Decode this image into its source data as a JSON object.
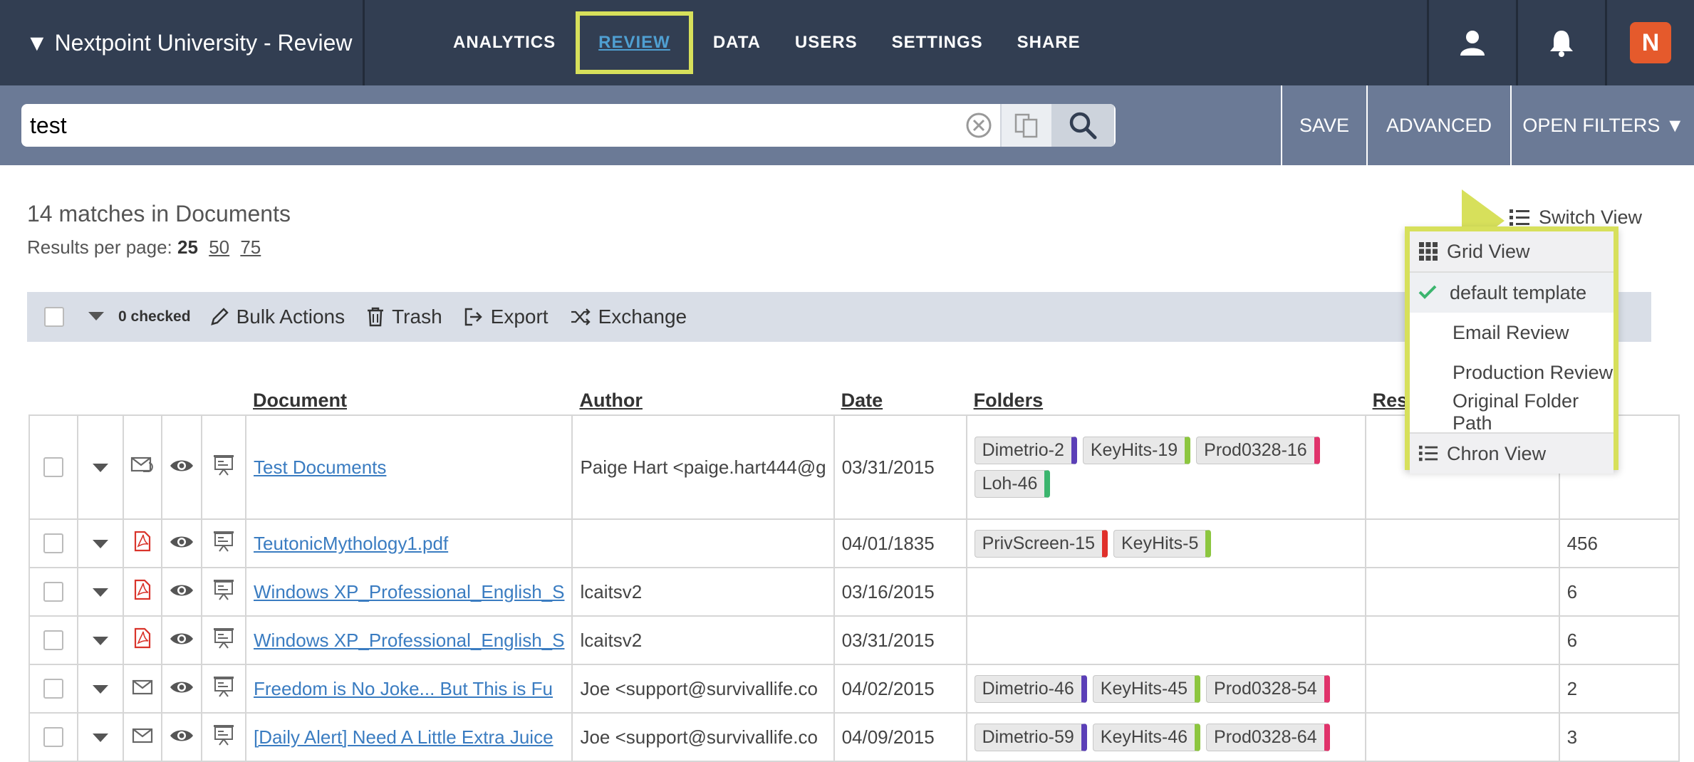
{
  "nav": {
    "brand": "▼ Nextpoint University - Review",
    "links": [
      "ANALYTICS",
      "REVIEW",
      "DATA",
      "USERS",
      "SETTINGS",
      "SHARE"
    ],
    "logo_letter": "N"
  },
  "search": {
    "value": "test",
    "save": "SAVE",
    "advanced": "ADVANCED",
    "open_filters": "OPEN FILTERS ▼"
  },
  "results": {
    "matches": "14 matches in Documents",
    "per_page_label": "Results per page:",
    "per_page_options": [
      "25",
      "50",
      "75"
    ]
  },
  "toolbar": {
    "checked": "0 checked",
    "bulk": "Bulk Actions",
    "trash": "Trash",
    "export": "Export",
    "exchange": "Exchange"
  },
  "switch_view": {
    "label": "Switch View",
    "grid_view": "Grid View",
    "templates": [
      "default template",
      "Email Review",
      "Production Review",
      "Original Folder Path"
    ],
    "chron_view": "Chron View"
  },
  "table": {
    "headers": [
      "Document",
      "Author",
      "Date",
      "Folders",
      "Respo"
    ],
    "rows": [
      {
        "doc": "Test Documents",
        "author": "Paige Hart <paige.hart444@g",
        "date": "03/31/2015",
        "tags": [
          [
            "Dimetrio-2",
            "#5b3fb7"
          ],
          [
            "KeyHits-19",
            "#8cc63f"
          ],
          [
            "Prod0328-16",
            "#e0336b"
          ],
          [
            "Loh-46",
            "#3bb56e"
          ]
        ],
        "last": ""
      },
      {
        "doc": "TeutonicMythology1.pdf",
        "author": "",
        "date": "04/01/1835",
        "tags": [
          [
            "PrivScreen-15",
            "#e0302b"
          ],
          [
            "KeyHits-5",
            "#8cc63f"
          ]
        ],
        "last": "456"
      },
      {
        "doc": "Windows XP_Professional_English_S",
        "author": "lcaitsv2",
        "date": "03/16/2015",
        "tags": [],
        "last": "6"
      },
      {
        "doc": "Windows XP_Professional_English_S",
        "author": "lcaitsv2",
        "date": "03/31/2015",
        "tags": [],
        "last": "6"
      },
      {
        "doc": "Freedom is No Joke... But This is Fu",
        "author": "Joe <support@survivallife.co",
        "date": "04/02/2015",
        "tags": [
          [
            "Dimetrio-46",
            "#5b3fb7"
          ],
          [
            "KeyHits-45",
            "#8cc63f"
          ],
          [
            "Prod0328-54",
            "#e0336b"
          ]
        ],
        "last": "2"
      },
      {
        "doc": "[Daily Alert] Need A Little Extra Juice",
        "author": "Joe <support@survivallife.co",
        "date": "04/09/2015",
        "tags": [
          [
            "Dimetrio-59",
            "#5b3fb7"
          ],
          [
            "KeyHits-46",
            "#8cc63f"
          ],
          [
            "Prod0328-64",
            "#e0336b"
          ]
        ],
        "last": "3"
      }
    ],
    "row_icons": [
      "email-attachment-icon",
      "pdf-icon",
      "pdf-icon",
      "pdf-icon",
      "email-icon",
      "email-icon"
    ]
  },
  "colors": {
    "nav_bg": "#323e52",
    "highlight": "#d7e05b",
    "link": "#3a7cc1"
  }
}
